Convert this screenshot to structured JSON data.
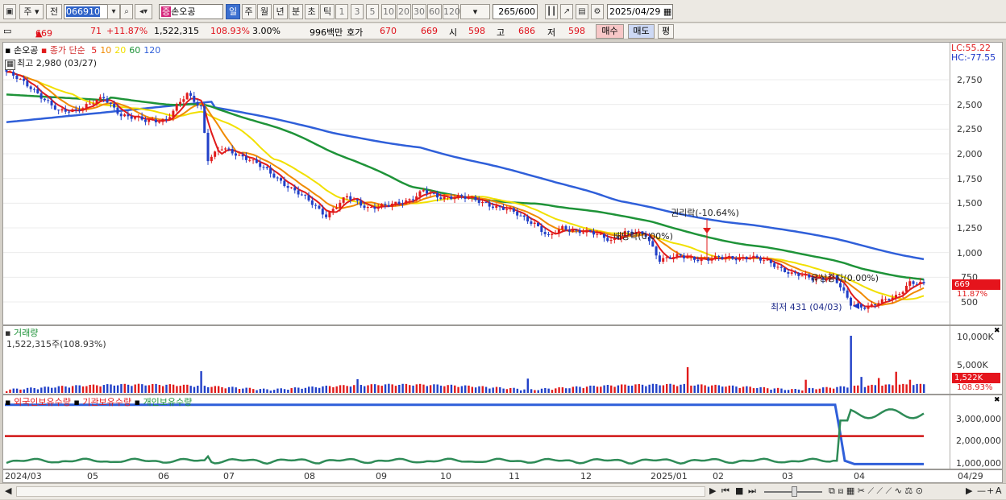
{
  "toolbar": {
    "market_label": "주",
    "mode_label": "전",
    "code_value": "066910",
    "stock_name": "손오공",
    "periods": [
      "일",
      "주",
      "월",
      "년",
      "분",
      "초",
      "틱"
    ],
    "active_period": "일",
    "minute_presets": [
      "1",
      "3",
      "5",
      "10",
      "20",
      "30",
      "60",
      "120"
    ],
    "count_value": "265",
    "count_max": "/600",
    "date_value": "2025/04/29"
  },
  "quote": {
    "price": "669",
    "change_arrow": "▲",
    "change": "71",
    "change_pct": "+11.87%",
    "volume": "1,522,315",
    "volume_ratio": "108.93%",
    "turnover_rate": "3.00%",
    "amount": "996백만",
    "bid_label": "호가",
    "bid_sell": "670",
    "bid_buy": "669",
    "open_label": "시",
    "open": "598",
    "high_label": "고",
    "high": "686",
    "low_label": "저",
    "low": "598",
    "buy_btn": "매수",
    "sell_btn": "매도",
    "eval_btn": "평"
  },
  "price_panel": {
    "stock_tag": "손오공",
    "ma_label": "종가 단순",
    "ma_periods": [
      "5",
      "10",
      "20",
      "60",
      "120"
    ],
    "ma_colors": [
      "#e11b1b",
      "#f08a00",
      "#f1e000",
      "#1e9338",
      "#2f5fd9"
    ],
    "high_note": "최고 2,980 (03/27)",
    "low_note": "최저 431 (04/03)",
    "lc": "LC:55.22",
    "hc": "HC:-77.55",
    "last_price_tag": "669",
    "last_pct_tag": "11.87%",
    "y_ticks": [
      "2,750",
      "2,500",
      "2,250",
      "2,000",
      "1,750",
      "1,500",
      "1,250",
      "1,000",
      "750",
      "500"
    ],
    "annotations": [
      "권리락(-10.64%)",
      "배당락(0.00%)",
      "유상증자(0.00%)"
    ]
  },
  "volume_panel": {
    "title": "거래량",
    "value": "1,522,315주(108.93%)",
    "y_ticks": [
      "10,000K",
      "5,000K"
    ],
    "last_tag": "1,522K",
    "last_pct": "108.93%"
  },
  "holdings_panel": {
    "legends": [
      "외국인보유수량",
      "기관보유수량",
      "개인보유수량"
    ],
    "legend_colors": [
      "#2f5fd9",
      "#e11b1b",
      "#1e9338"
    ],
    "y_ticks": [
      "3,000,000",
      "2,000,000",
      "1,000,000"
    ]
  },
  "x_axis": [
    "2024/03",
    "05",
    "06",
    "07",
    "08",
    "09",
    "10",
    "11",
    "12",
    "2025/01",
    "02",
    "03",
    "04",
    "04/29"
  ],
  "chart_data": {
    "type": "candlestick",
    "x": [
      "2024/03",
      "05",
      "06",
      "07",
      "08",
      "09",
      "10",
      "11",
      "12",
      "2025/01",
      "02",
      "03",
      "04"
    ],
    "close_approx": [
      2800,
      2500,
      2300,
      2000,
      1400,
      1480,
      1560,
      1150,
      1150,
      950,
      940,
      760,
      669
    ],
    "ylim": [
      430,
      3000
    ],
    "high": {
      "value": 2980,
      "date": "03/27"
    },
    "low": {
      "value": 431,
      "date": "04/03"
    },
    "last": 669
  },
  "colors": {
    "up": "#e11b1b",
    "down": "#2140c8",
    "accent": "#3b6fd0"
  }
}
